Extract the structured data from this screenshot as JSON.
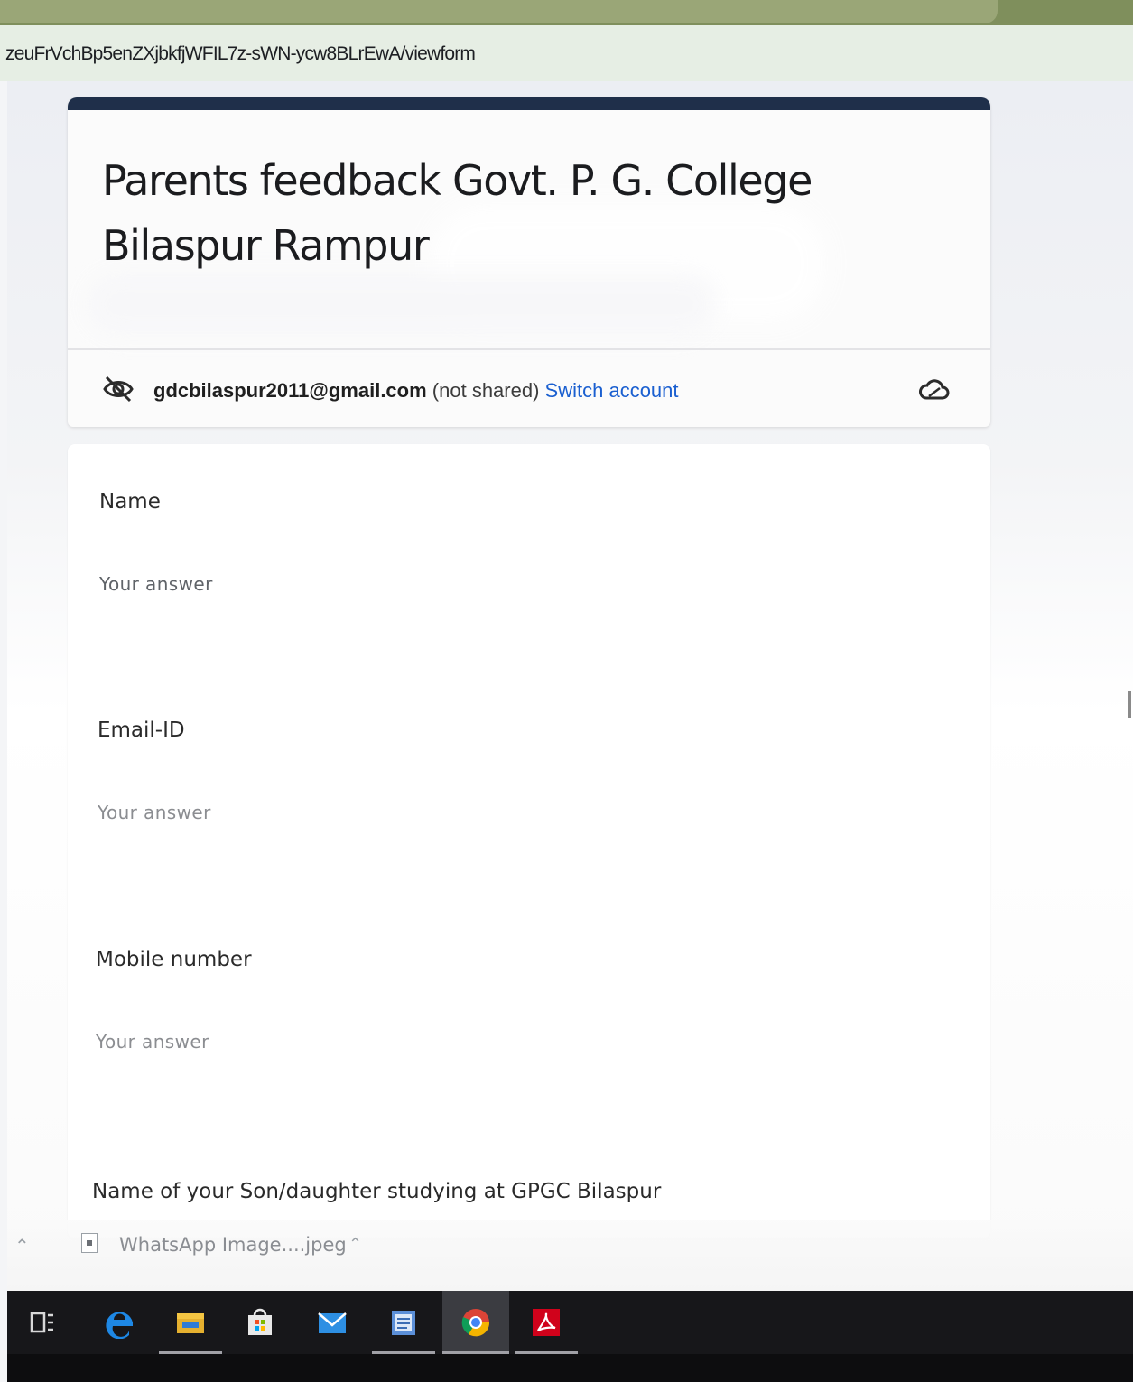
{
  "browser": {
    "url": "zeuFrVchBp5enZXjbkfjWFIL7z-sWN-ycw8BLrEwA/viewform"
  },
  "form": {
    "title_line1": "Parents feedback Govt. P. G. College",
    "title_line2": "Bilaspur Rampur",
    "account": {
      "email": "gdcbilaspur2011@gmail.com",
      "shared_note": "(not shared)",
      "switch_label": "Switch account",
      "privacy_icon": "eye-off-icon",
      "save_icon": "cloud-icon"
    },
    "questions": [
      {
        "label": "Name",
        "placeholder": "Your answer"
      },
      {
        "label": "Email-ID",
        "placeholder": "Your answer"
      },
      {
        "label": "Mobile number",
        "placeholder": "Your answer"
      },
      {
        "label": "Name of your Son/daughter studying at GPGC Bilaspur"
      }
    ]
  },
  "downloads": {
    "file_name": "WhatsApp Image....jpeg"
  },
  "taskbar": {
    "items": [
      {
        "name": "task-view",
        "icon": "task-view-icon"
      },
      {
        "name": "edge",
        "icon": "edge-icon"
      },
      {
        "name": "file-explorer",
        "icon": "folder-icon"
      },
      {
        "name": "store",
        "icon": "store-icon"
      },
      {
        "name": "mail",
        "icon": "mail-icon"
      },
      {
        "name": "word",
        "icon": "word-icon"
      },
      {
        "name": "chrome",
        "icon": "chrome-icon"
      },
      {
        "name": "acrobat",
        "icon": "acrobat-icon"
      }
    ],
    "colors": {
      "edge": "#1e88e5",
      "folder": "#f4c542",
      "chrome_red": "#db4437",
      "acrobat": "#d0021b"
    }
  },
  "colors": {
    "form_header_bar": "#1f2f4a",
    "switch_link": "#1a5fd0",
    "taskbar_bg": "#17171a"
  }
}
